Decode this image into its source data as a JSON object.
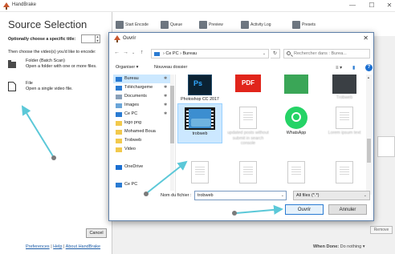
{
  "app": {
    "title": "HandBrake",
    "window_controls": [
      "—",
      "☐",
      "✕"
    ]
  },
  "toolbar": {
    "buttons": [
      {
        "label": "Start Encode",
        "icon": "start-encode-icon"
      },
      {
        "label": "Queue",
        "icon": "queue-icon"
      },
      {
        "label": "Preview",
        "icon": "preview-icon"
      },
      {
        "label": "Activity Log",
        "icon": "activity-log-icon"
      },
      {
        "label": "Presets",
        "icon": "presets-icon"
      }
    ]
  },
  "source_panel": {
    "title": "Source Selection",
    "optional_title_label": "Optionally choose a specific title:",
    "choose_text": "Then choose the video(s) you'd like to encode:",
    "folder_option": {
      "name": "Folder (Batch Scan)",
      "desc": "Open a folder with one or more files."
    },
    "file_option": {
      "name": "File",
      "desc": "Open a single video file."
    },
    "cancel_label": "Cancel",
    "links": {
      "preferences": "Preferences",
      "help": "Help",
      "about": "About HandBrake",
      "separator": "|"
    }
  },
  "main": {
    "remove_label": "Remove",
    "when_done_label": "When Done:",
    "when_done_value": "Do nothing ▾"
  },
  "dialog": {
    "title": "Ouvrir",
    "close": "✕",
    "nav_buttons": {
      "back": "←",
      "forward": "→",
      "dropdown": "⌄",
      "up": "↑"
    },
    "address_path": "›  Ce PC  ›  Bureau",
    "address_dropdown": "⌄",
    "refresh": "↻",
    "search_placeholder": "Rechercher dans : Burea...",
    "organize_label": "Organiser ▾",
    "new_folder_label": "Nouveau dossier",
    "view_icons": [
      "≡ ▾",
      "▮"
    ],
    "help": "?",
    "nav_items": [
      {
        "label": "Bureau",
        "icon": "desktop-folder-icon",
        "color": "#2a7bd2",
        "pinned": true,
        "selected": true
      },
      {
        "label": "Téléchargeme",
        "icon": "downloads-folder-icon",
        "color": "#2a7bd2",
        "pinned": true,
        "selected": false
      },
      {
        "label": "Documents",
        "icon": "documents-folder-icon",
        "color": "#8aa0b8",
        "pinned": true,
        "selected": false
      },
      {
        "label": "Images",
        "icon": "images-folder-icon",
        "color": "#6aa5d8",
        "pinned": true,
        "selected": false
      },
      {
        "label": "Ce PC",
        "icon": "computer-icon",
        "color": "#2a7bd2",
        "pinned": true,
        "selected": false
      },
      {
        "label": "logo png",
        "icon": "folder-icon",
        "color": "#f2c94c",
        "pinned": false,
        "selected": false
      },
      {
        "label": "Mohamed Boua",
        "icon": "folder-icon",
        "color": "#f2c94c",
        "pinned": false,
        "selected": false
      },
      {
        "label": "Trobweb",
        "icon": "folder-icon",
        "color": "#f2c94c",
        "pinned": false,
        "selected": false
      },
      {
        "label": "Video",
        "icon": "folder-icon",
        "color": "#f2c94c",
        "pinned": false,
        "selected": false
      },
      {
        "label": "",
        "icon": "spacer",
        "color": "",
        "pinned": false,
        "selected": false
      },
      {
        "label": "OneDrive",
        "icon": "onedrive-icon",
        "color": "#1b6fd1",
        "pinned": false,
        "selected": false
      },
      {
        "label": "",
        "icon": "spacer",
        "color": "",
        "pinned": false,
        "selected": false
      },
      {
        "label": "Ce PC",
        "icon": "computer-icon",
        "color": "#2a7bd2",
        "pinned": false,
        "selected": false
      }
    ],
    "pin_glyph": "✱",
    "files": [
      {
        "name": "Photoshop CC 2017",
        "kind": "photoshop-icon",
        "blurred": false,
        "selected": false
      },
      {
        "name": "PDF",
        "kind": "pdf-icon",
        "blurred": false,
        "selected": false
      },
      {
        "name": "",
        "kind": "green-icon",
        "blurred": false,
        "selected": false
      },
      {
        "name": "Trobweb",
        "kind": "dark-icon",
        "blurred": true,
        "selected": false
      },
      {
        "name": "trobweb",
        "kind": "video-file-icon",
        "blurred": false,
        "selected": true
      },
      {
        "name": "updated posts without submit in search console",
        "kind": "document-icon",
        "blurred": true,
        "selected": false
      },
      {
        "name": "WhatsApp",
        "kind": "whatsapp-icon",
        "blurred": false,
        "selected": false
      },
      {
        "name": "Lorem ipsum text",
        "kind": "document-icon",
        "blurred": true,
        "selected": false
      }
    ],
    "file_name_label": "Nom du fichier :",
    "file_name_value": "trobweb",
    "file_type_value": "All files (*.*)",
    "open_label": "Ouvrir",
    "cancel_label": "Annuler"
  },
  "colors": {
    "accent": "#2a7bd2",
    "selection": "#cce8ff",
    "annotation": "#5bc8d8"
  }
}
